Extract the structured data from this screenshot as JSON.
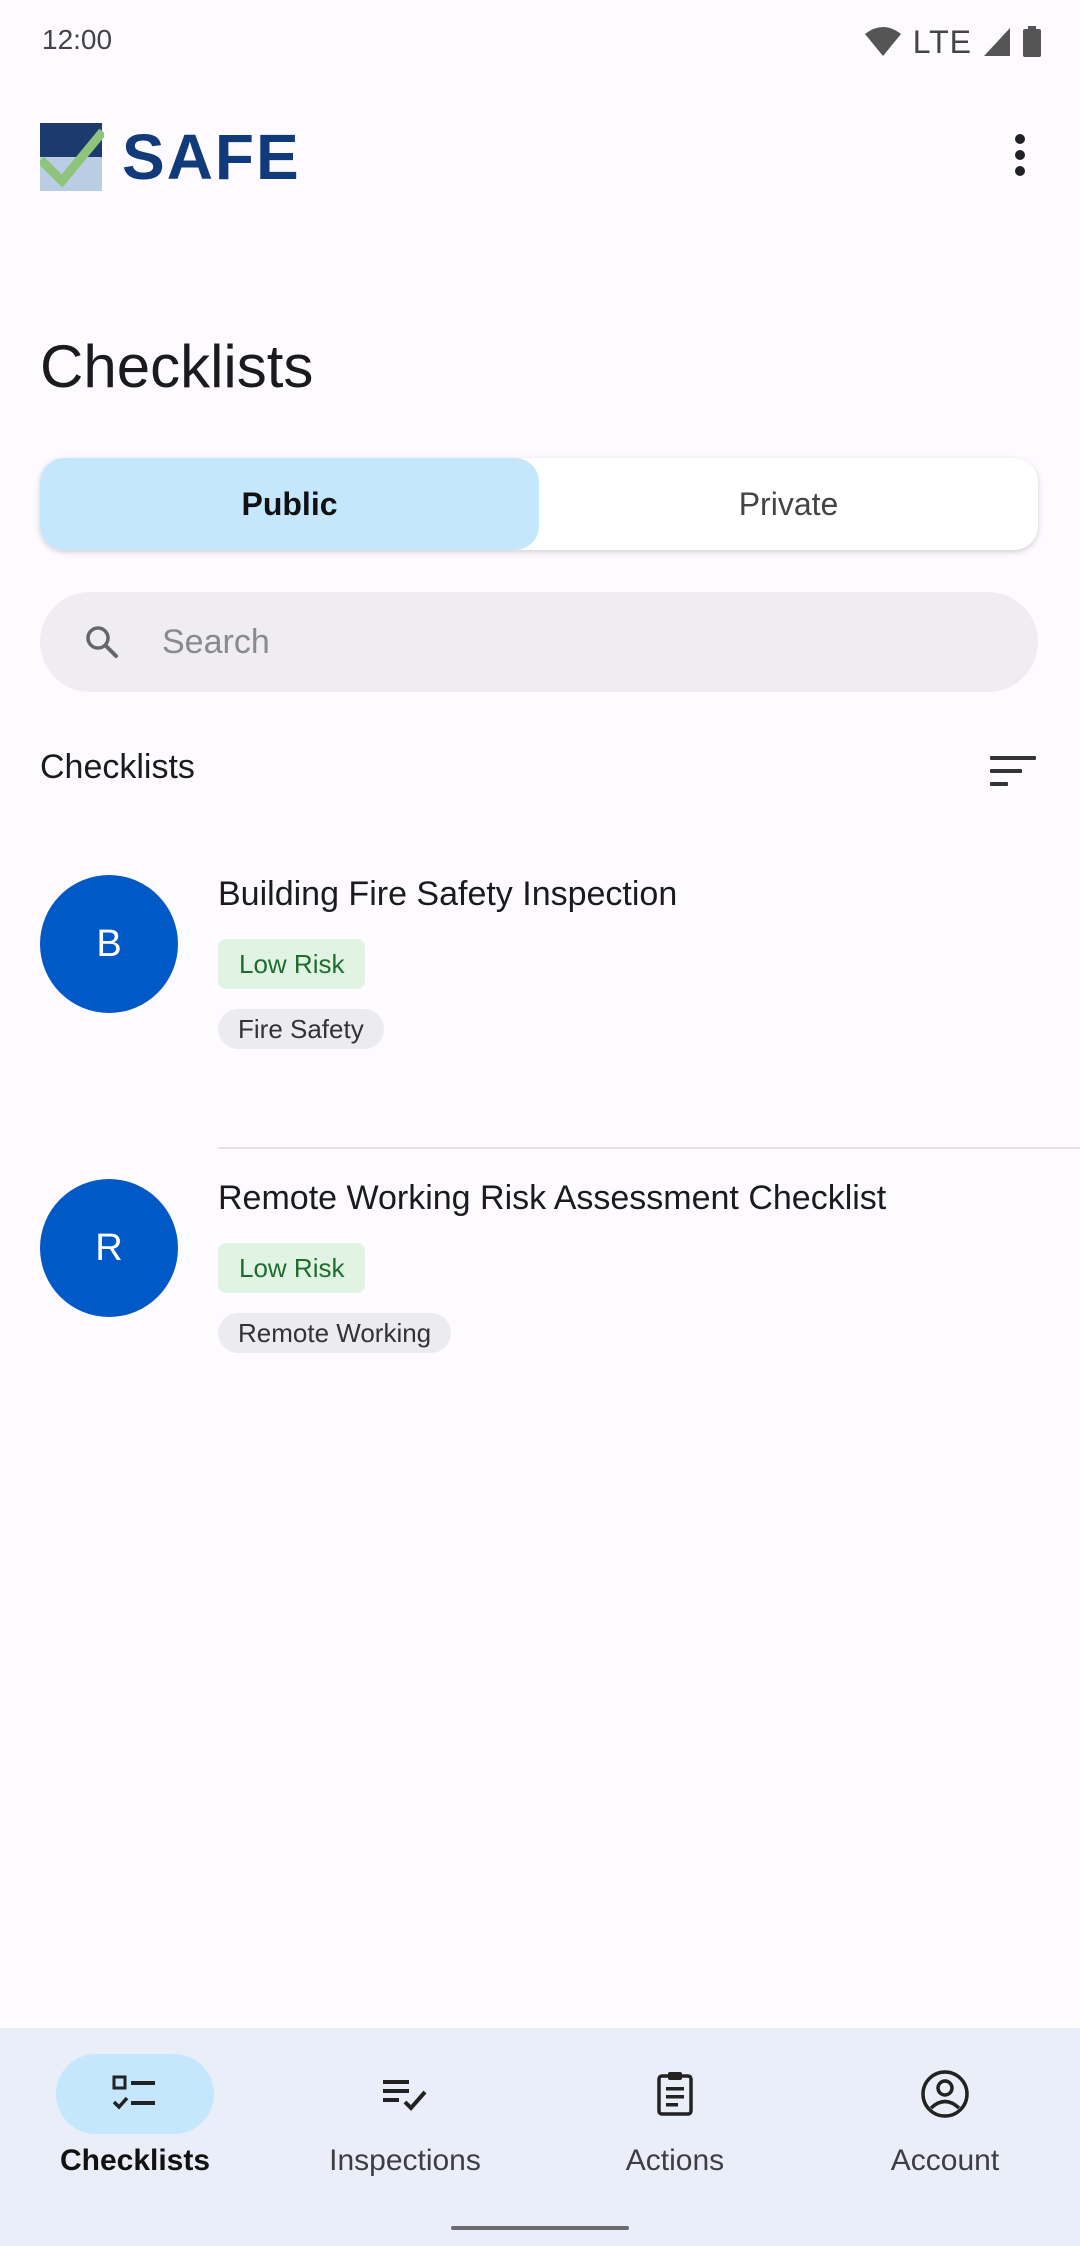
{
  "status_bar": {
    "time": "12:00",
    "network": "LTE"
  },
  "app": {
    "logo_text": "SAFE"
  },
  "page": {
    "title": "Checklists"
  },
  "segment": {
    "public_label": "Public",
    "private_label": "Private",
    "selected": "Public"
  },
  "search": {
    "placeholder": "Search",
    "value": ""
  },
  "section": {
    "title": "Checklists"
  },
  "checklists": [
    {
      "initial": "B",
      "title": "Building Fire Safety Inspection",
      "risk": "Low Risk",
      "tag": "Fire Safety"
    },
    {
      "initial": "R",
      "title": "Remote Working Risk Assessment Checklist",
      "risk": "Low Risk",
      "tag": "Remote Working"
    }
  ],
  "bottom_nav": {
    "items": [
      {
        "label": "Checklists",
        "icon": "checklist-icon",
        "active": true
      },
      {
        "label": "Inspections",
        "icon": "inspections-icon",
        "active": false
      },
      {
        "label": "Actions",
        "icon": "clipboard-icon",
        "active": false
      },
      {
        "label": "Account",
        "icon": "account-circle-icon",
        "active": false
      }
    ]
  },
  "colors": {
    "accent": "#c4e7fd",
    "avatar": "#0059c7",
    "logo_blue": "#113a7a",
    "risk_low_bg": "#e1f3e3",
    "risk_low_text": "#1f6d2e"
  }
}
